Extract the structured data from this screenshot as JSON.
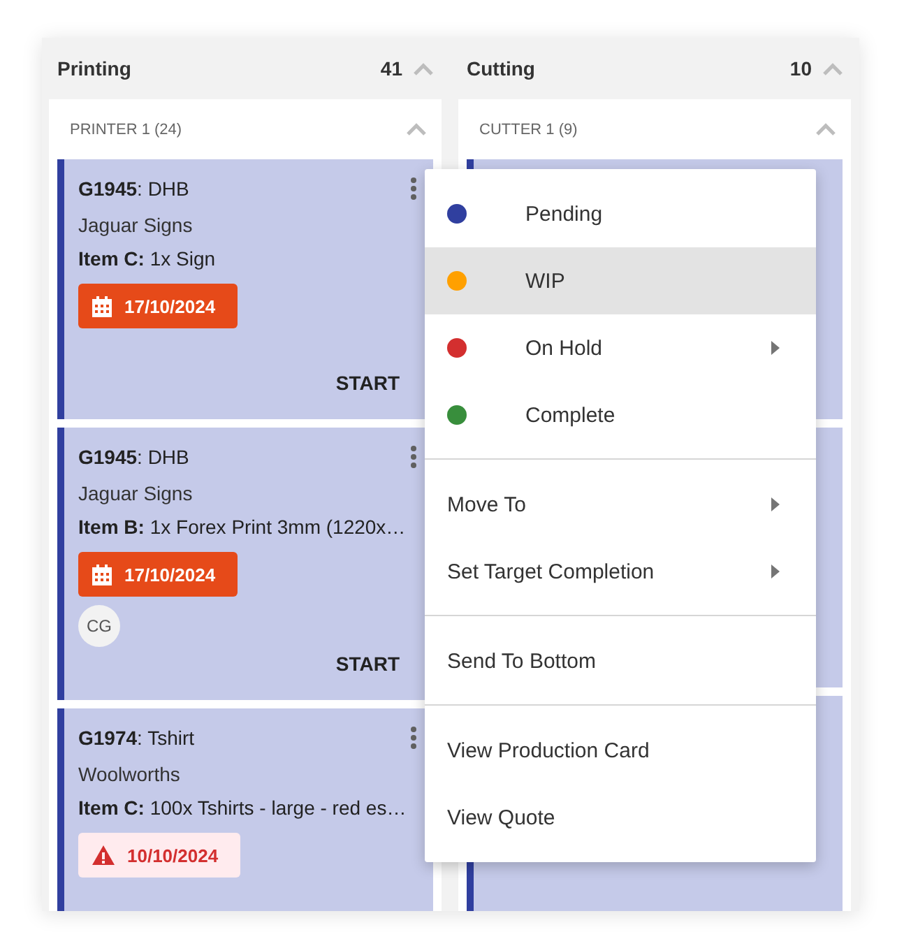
{
  "columns": [
    {
      "title": "Printing",
      "count": "41",
      "groups": [
        {
          "title": "PRINTER 1 (24)",
          "expanded": true,
          "cards": [
            {
              "kind": "job",
              "title": "**G1945**: DHB",
              "customer": "Jaguar Signs",
              "item_label": "Item C:",
              "item_text": "1x Sign",
              "date": {
                "kind": "due",
                "text": "17/10/2024"
              },
              "action": "START"
            },
            {
              "kind": "job",
              "title": "**G1945**: DHB",
              "customer": "Jaguar Signs",
              "item_label": "Item B:",
              "item_text": "1x Forex Print 3mm (1220x…",
              "date": {
                "kind": "due",
                "text": "17/10/2024"
              },
              "assignees": [
                "CG"
              ],
              "action": "START"
            },
            {
              "kind": "job",
              "title": "**G1974**: Tshirt",
              "customer": "Woolworths",
              "item_label": "Item C:",
              "item_text": "100x Tshirts - large - red es…",
              "date": {
                "kind": "overdue",
                "text": "10/10/2024"
              }
            }
          ]
        }
      ]
    },
    {
      "title": "Cutting",
      "count": "10",
      "groups": [
        {
          "title": "CUTTER 1 (9)",
          "expanded": true,
          "cards": [
            {
              "kind": "covered"
            },
            {
              "kind": "covered"
            },
            {
              "kind": "covered"
            }
          ]
        }
      ]
    }
  ],
  "menu": {
    "sections": [
      {
        "items": [
          {
            "label": "Pending",
            "color": "#303f9f",
            "submenu": false,
            "selected": false
          },
          {
            "label": "WIP",
            "color": "#ffa000",
            "submenu": false,
            "selected": true
          },
          {
            "label": "On Hold",
            "color": "#d32f2f",
            "submenu": true,
            "selected": false
          },
          {
            "label": "Complete",
            "color": "#388e3c",
            "submenu": false,
            "selected": false
          }
        ]
      },
      {
        "items": [
          {
            "label": "Move To",
            "submenu": true,
            "selected": false
          },
          {
            "label": "Set Target Completion",
            "submenu": true,
            "selected": false
          }
        ]
      },
      {
        "items": [
          {
            "label": "Send To Bottom",
            "submenu": false,
            "selected": false
          }
        ]
      },
      {
        "items": [
          {
            "label": "View Production Card",
            "submenu": false,
            "selected": false
          },
          {
            "label": "View Quote",
            "submenu": false,
            "selected": false
          }
        ]
      }
    ]
  }
}
